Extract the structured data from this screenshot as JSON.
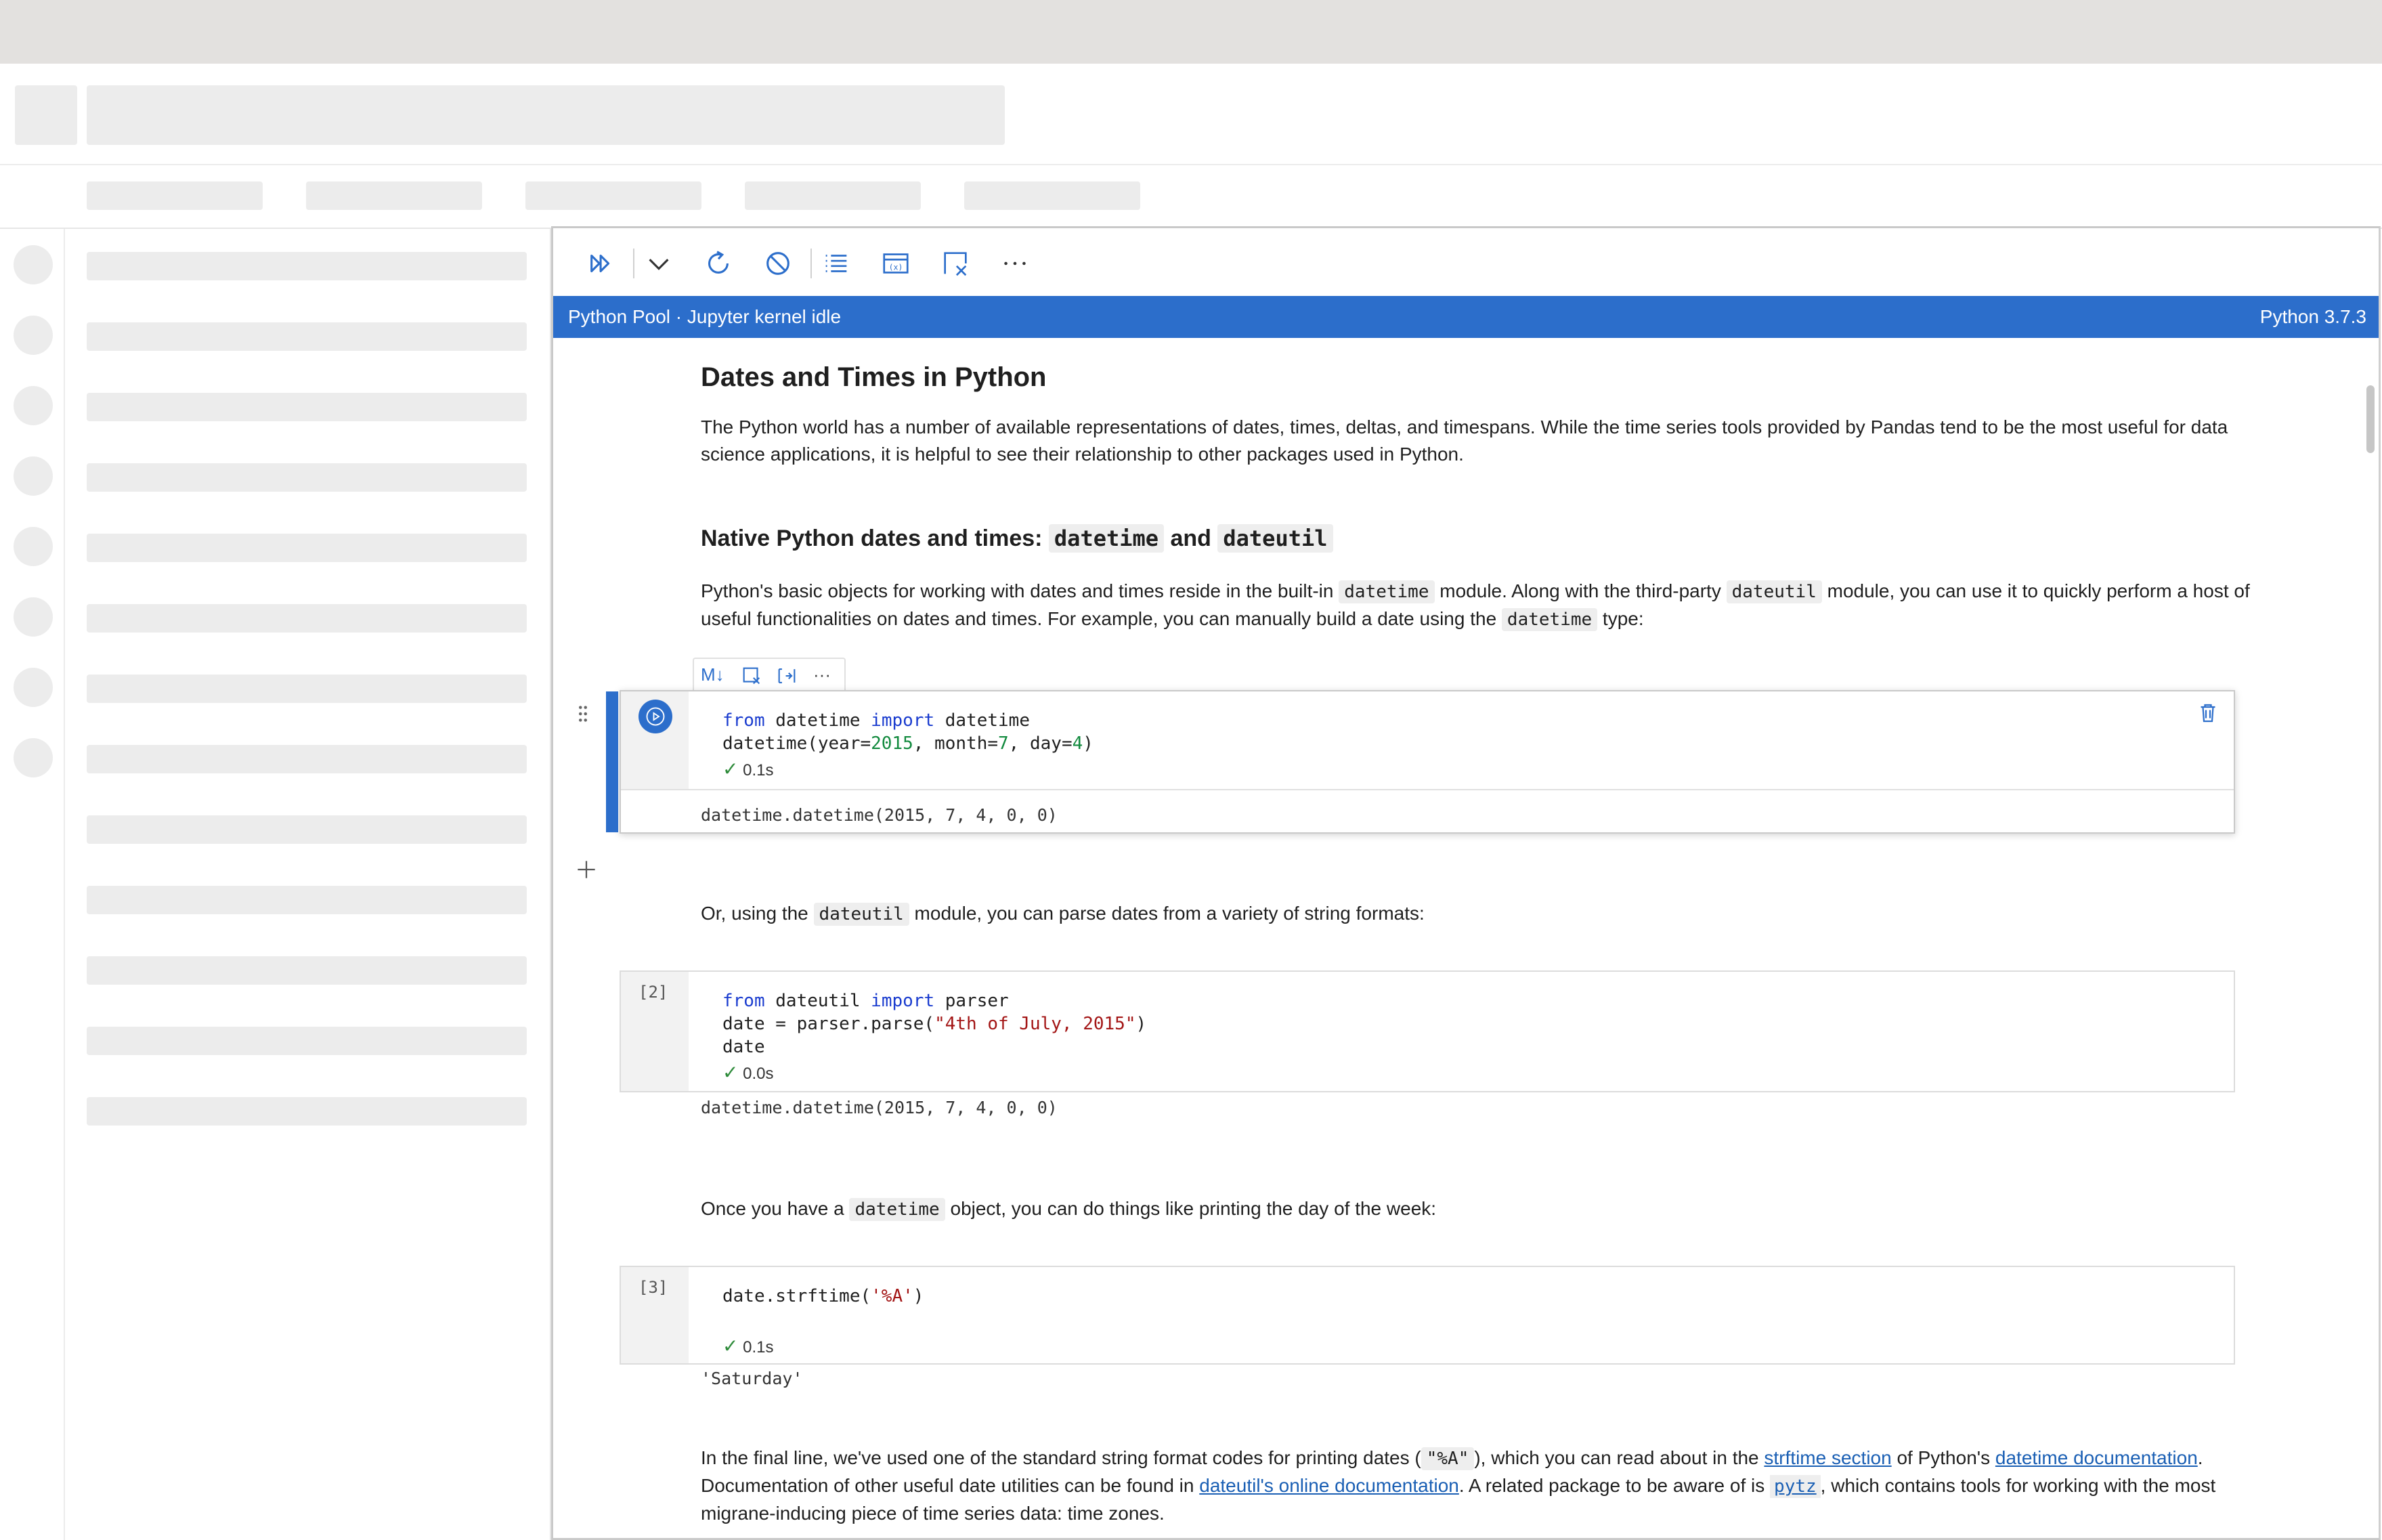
{
  "notebook": {
    "status_left": "Python Pool · Jupyter kernel idle",
    "status_right": "Python 3.7.3",
    "accent_color": "#2c6ecb",
    "toolbar_icons": [
      "run-all-icon",
      "chevron-down-icon",
      "restart-icon",
      "interrupt-icon",
      "outline-icon",
      "variables-icon",
      "clear-outputs-icon",
      "more-icon"
    ]
  },
  "markdown": {
    "title": "Dates and Times in Python",
    "intro": "The Python world has a number of available representations of dates, times, deltas, and timespans. While the time series tools provided by Pandas tend to be the most useful for data science applications, it is helpful to see their relationship to other packages used in Python.",
    "h2_prefix": "Native Python dates and times: ",
    "h2_code1": "datetime",
    "h2_and": " and ",
    "h2_code2": "dateutil",
    "p2_a": "Python's basic objects for working with dates and times reside in the built-in ",
    "p2_code1": "datetime",
    "p2_b": " module. Along with the third-party ",
    "p2_code2": "dateutil",
    "p2_c": " module, you can use it to quickly perform a host of useful functionalities on dates and times. For example, you can manually build a date using the ",
    "p2_code3": "datetime",
    "p2_d": " type:",
    "p3_a": "Or, using the ",
    "p3_code": "dateutil",
    "p3_b": " module, you can parse dates from a variety of string formats:",
    "p4_a": "Once you have a ",
    "p4_code": "datetime",
    "p4_b": " object, you can do things like printing the day of the week:",
    "p5_a": "In the final line, we've used one of the standard string format codes for printing dates (",
    "p5_code": "\"%A\"",
    "p5_b": "), which you can read about in the ",
    "p5_link1": "strftime section",
    "p5_c": " of Python's ",
    "p5_link2": "datetime documentation",
    "p5_d": ". Documentation of other useful date utilities can be found in ",
    "p5_link3": "dateutil's online documentation",
    "p5_e": ". A related package to be aware of is ",
    "p5_link4": "pytz",
    "p5_f": ", which contains tools for working with the most migrane-inducing piece of time series data: time zones."
  },
  "cells": [
    {
      "prompt": "",
      "line1_kw1": "from",
      "line1_mid": " datetime ",
      "line1_kw2": "import",
      "line1_end": " datetime",
      "line2_a": "datetime(year=",
      "line2_n1": "2015",
      "line2_b": ", month=",
      "line2_n2": "7",
      "line2_c": ", day=",
      "line2_n3": "4",
      "line2_d": ")",
      "time": "0.1s",
      "output": "datetime.datetime(2015, 7, 4, 0, 0)"
    },
    {
      "prompt": "[2]",
      "line1_kw1": "from",
      "line1_mid": " dateutil ",
      "line1_kw2": "import",
      "line1_end": " parser",
      "line2_a": "date = parser.parse(",
      "line2_str": "\"4th of July, 2015\"",
      "line2_b": ")",
      "line3": "date",
      "time": "0.0s",
      "output": "datetime.datetime(2015, 7, 4, 0, 0)"
    },
    {
      "prompt": "[3]",
      "line1_a": "date.strftime(",
      "line1_str": "'%A'",
      "line1_b": ")",
      "time": "0.1s",
      "output": "'Saturday'"
    }
  ],
  "cell_toolbar": [
    "M↓",
    "split-icon",
    "join-icon",
    "···"
  ]
}
